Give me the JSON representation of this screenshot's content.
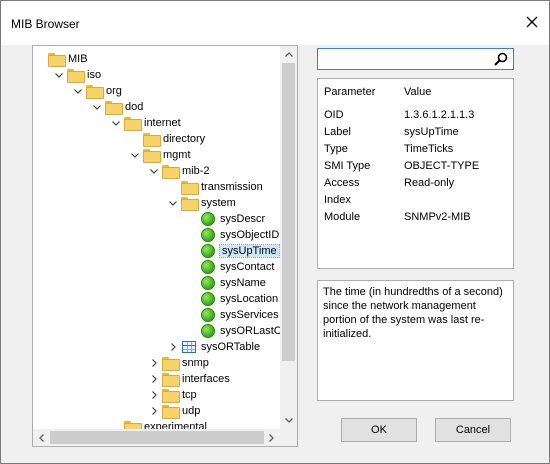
{
  "window": {
    "title": "MIB Browser"
  },
  "search": {
    "value": "",
    "placeholder": ""
  },
  "tree": {
    "rows": [
      {
        "label": "MIB",
        "icon": "folder-icon",
        "expander": "none"
      },
      {
        "label": "iso",
        "icon": "folder-icon",
        "expander": "expanded"
      },
      {
        "label": "org",
        "icon": "folder-icon",
        "expander": "expanded"
      },
      {
        "label": "dod",
        "icon": "folder-icon",
        "expander": "expanded"
      },
      {
        "label": "internet",
        "icon": "folder-icon",
        "expander": "expanded"
      },
      {
        "label": "directory",
        "icon": "folder-icon",
        "expander": "none"
      },
      {
        "label": "mgmt",
        "icon": "folder-icon",
        "expander": "expanded"
      },
      {
        "label": "mib-2",
        "icon": "folder-icon",
        "expander": "expanded"
      },
      {
        "label": "transmission",
        "icon": "folder-icon",
        "expander": "none"
      },
      {
        "label": "system",
        "icon": "folder-icon",
        "expander": "expanded"
      },
      {
        "label": "sysDescr",
        "icon": "leaf-icon",
        "expander": "none"
      },
      {
        "label": "sysObjectID",
        "icon": "leaf-icon",
        "expander": "none"
      },
      {
        "label": "sysUpTime",
        "icon": "leaf-icon",
        "expander": "none",
        "selected": true
      },
      {
        "label": "sysContact",
        "icon": "leaf-icon",
        "expander": "none"
      },
      {
        "label": "sysName",
        "icon": "leaf-icon",
        "expander": "none"
      },
      {
        "label": "sysLocation",
        "icon": "leaf-icon",
        "expander": "none"
      },
      {
        "label": "sysServices",
        "icon": "leaf-icon",
        "expander": "none"
      },
      {
        "label": "sysORLastChar",
        "icon": "leaf-icon",
        "expander": "none"
      },
      {
        "label": "sysORTable",
        "icon": "table-icon",
        "expander": "collapsed"
      },
      {
        "label": "snmp",
        "icon": "folder-icon",
        "expander": "collapsed"
      },
      {
        "label": "interfaces",
        "icon": "folder-icon",
        "expander": "collapsed"
      },
      {
        "label": "tcp",
        "icon": "folder-icon",
        "expander": "collapsed"
      },
      {
        "label": "udp",
        "icon": "folder-icon",
        "expander": "collapsed"
      },
      {
        "label": "experimental",
        "icon": "folder-icon",
        "expander": "none"
      }
    ]
  },
  "properties": {
    "header": {
      "parameter": "Parameter",
      "value": "Value"
    },
    "rows": [
      {
        "parameter": "OID",
        "value": "1.3.6.1.2.1.1.3"
      },
      {
        "parameter": "Label",
        "value": "sysUpTime"
      },
      {
        "parameter": "Type",
        "value": "TimeTicks"
      },
      {
        "parameter": "SMI Type",
        "value": "OBJECT-TYPE"
      },
      {
        "parameter": "Access",
        "value": "Read-only"
      },
      {
        "parameter": "Index",
        "value": ""
      },
      {
        "parameter": "Module",
        "value": "SNMPv2-MIB"
      }
    ]
  },
  "description": {
    "text": "The time (in hundredths of a second) since the network management portion of the system was last re-initialized."
  },
  "buttons": {
    "ok": "OK",
    "cancel": "Cancel"
  },
  "colors": {
    "selection": "#cce8ff",
    "focus_border": "#3b7fd0",
    "folder": "#f6d36b",
    "leaf": "#3fb21d"
  }
}
